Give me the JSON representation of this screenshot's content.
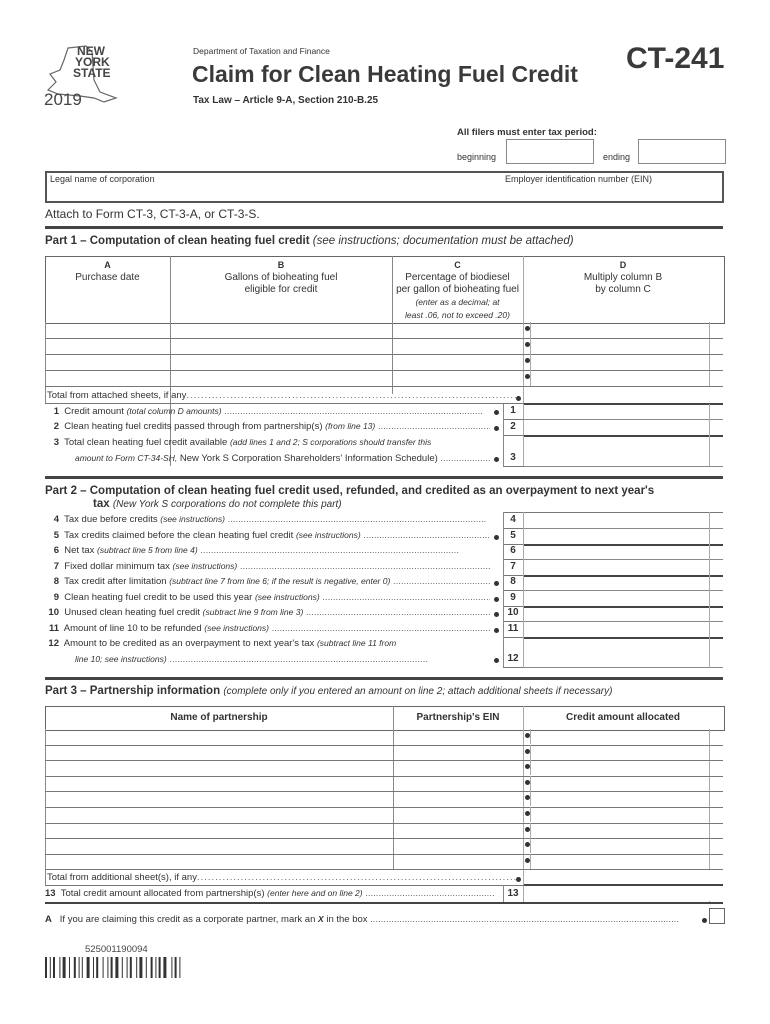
{
  "header": {
    "logo": {
      "state_name": "NEW YORK STATE",
      "line1": "NEW",
      "line2": "YORK",
      "line3": "STATE",
      "year": "2019",
      "icon": "ny-state-map-icon"
    },
    "department": "Department of Taxation and Finance",
    "title": "Claim for Clean Heating Fuel Credit",
    "subtitle": "Tax Law – Article 9-A, Section 210-B.25",
    "form_number": "CT-241"
  },
  "tax_period": {
    "label": "All filers must enter tax period:",
    "beginning_label": "beginning",
    "beginning_value": "",
    "ending_label": "ending",
    "ending_value": ""
  },
  "identity": {
    "legal_name_label": "Legal name of corporation",
    "legal_name_value": "",
    "ein_label": "Employer identification number (EIN)",
    "ein_value": ""
  },
  "attach_note": "Attach to Form CT-3, CT-3-A, or CT-3-S.",
  "part1": {
    "title": "Part 1 – Computation of clean heating fuel credit",
    "note": "(see instructions; documentation must be attached)",
    "columns": [
      {
        "letter": "A",
        "label": "Purchase date",
        "label2": "",
        "note": ""
      },
      {
        "letter": "B",
        "label": "Gallons of bioheating fuel",
        "label2": "eligible for credit",
        "note": ""
      },
      {
        "letter": "C",
        "label": "Percentage of biodiesel",
        "label2": "per gallon of bioheating fuel",
        "note": "(enter as a decimal; at",
        "note2": "least .06, not to exceed .20)"
      },
      {
        "letter": "D",
        "label": "Multiply column B",
        "label2": "by column C",
        "note": ""
      }
    ],
    "rows": [
      {
        "a": "",
        "b": "",
        "c": "",
        "d": ""
      },
      {
        "a": "",
        "b": "",
        "c": "",
        "d": ""
      },
      {
        "a": "",
        "b": "",
        "c": "",
        "d": ""
      },
      {
        "a": "",
        "b": "",
        "c": "",
        "d": ""
      }
    ],
    "total_label": "Total from attached sheets, if any",
    "total_value": "",
    "lines": [
      {
        "num": "1",
        "text": "Credit amount",
        "note": "(total column D amounts)",
        "value": ""
      },
      {
        "num": "2",
        "text": "Clean heating fuel credits passed through from partnership(s)",
        "note": "(from line 13)",
        "value": ""
      },
      {
        "num": "3",
        "text": "Total clean heating fuel credit available",
        "note": "(add lines 1 and 2; S corporations should transfer this",
        "cont_note": "amount to Form CT-34-SH,",
        "cont_text": "New York S Corporation Shareholders' Information Schedule)",
        "value": ""
      }
    ]
  },
  "part2": {
    "title": "Part 2 – Computation of clean heating fuel credit used, refunded, and credited as an overpayment to next year's",
    "title2": "tax",
    "note": "(New York S corporations do not complete this part)",
    "lines": [
      {
        "num": "4",
        "text": "Tax due before credits",
        "note": "(see instructions)",
        "value": ""
      },
      {
        "num": "5",
        "text": "Tax credits claimed before the clean heating fuel credit",
        "note": "(see instructions)",
        "value": ""
      },
      {
        "num": "6",
        "text": "Net tax",
        "note": "(subtract line 5 from line 4)",
        "value": ""
      },
      {
        "num": "7",
        "text": "Fixed dollar minimum tax",
        "note": "(see instructions)",
        "value": ""
      },
      {
        "num": "8",
        "text": "Tax credit after limitation",
        "note": "(subtract line 7 from line 6; if the result is negative, enter 0)",
        "value": ""
      },
      {
        "num": "9",
        "text": "Clean heating fuel credit to be used this year",
        "note": "(see instructions)",
        "value": ""
      },
      {
        "num": "10",
        "text": "Unused clean heating fuel credit",
        "note": "(subtract line 9 from line 3)",
        "value": ""
      },
      {
        "num": "11",
        "text": "Amount of line 10 to be refunded",
        "note": "(see instructions)",
        "value": ""
      },
      {
        "num": "12",
        "text": "Amount to be credited as an overpayment to next year's tax",
        "note": "(subtract line 11 from",
        "cont_note": "line 10; see instructions)",
        "value": ""
      }
    ]
  },
  "part3": {
    "title": "Part 3 – Partnership information",
    "note": "(complete only if you entered an amount on line 2; attach additional sheets if necessary)",
    "columns": [
      "Name of partnership",
      "Partnership's EIN",
      "Credit amount allocated"
    ],
    "rows": [
      {
        "name": "",
        "ein": "",
        "amount": ""
      },
      {
        "name": "",
        "ein": "",
        "amount": ""
      },
      {
        "name": "",
        "ein": "",
        "amount": ""
      },
      {
        "name": "",
        "ein": "",
        "amount": ""
      },
      {
        "name": "",
        "ein": "",
        "amount": ""
      },
      {
        "name": "",
        "ein": "",
        "amount": ""
      },
      {
        "name": "",
        "ein": "",
        "amount": ""
      },
      {
        "name": "",
        "ein": "",
        "amount": ""
      },
      {
        "name": "",
        "ein": "",
        "amount": ""
      }
    ],
    "total_label": "Total from additional sheet(s), if any",
    "total_value": "",
    "line13": {
      "num": "13",
      "text": "Total credit amount allocated from partnership(s)",
      "note": "(enter here and on line 2)",
      "value": ""
    }
  },
  "line_a": {
    "letter": "A",
    "text": "If you are claiming this credit as a corporate partner, mark an",
    "x": "X",
    "text2": "in the box",
    "checked": false
  },
  "footer": {
    "barcode_number": "525001190094"
  }
}
